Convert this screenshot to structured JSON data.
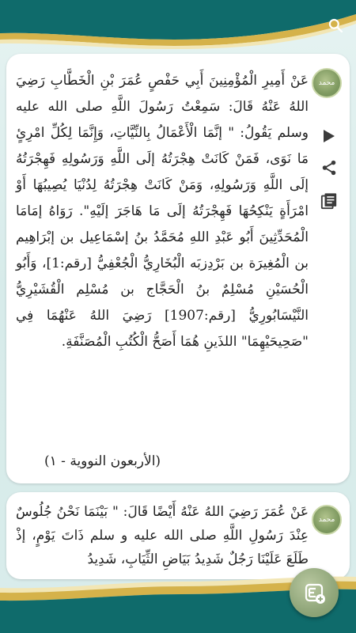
{
  "colors": {
    "header_teal": "#0f6b6b",
    "gold": "#d5b24a",
    "badge_green": "#7f9a61",
    "icon_dark": "#3b3b3b"
  },
  "icons": {
    "search": "search-icon",
    "play": "play-icon",
    "share": "share-icon",
    "notes": "notes-icon",
    "language": "language-icon"
  },
  "hadiths": [
    {
      "badge_label": "محمد",
      "text": "عَنْ أَمِيرِ الْمُؤْمِنِينَ أَبِي حَفْصٍ عُمَرَ بْنِ الْخَطَّابِ رَضِيَ اللهُ عَنْهُ قَالَ: سَمِعْتُ رَسُولَ اللَّهِ صلى الله عليه وسلم يَقُولُ: \" إنَّمَا الْأَعْمَالُ بِالنِّيَّاتِ، وَإِنَّمَا لِكُلِّ امْرِئٍ مَا نَوَى، فَمَنْ كَانَتْ هِجْرَتُهُ إلَى اللَّهِ وَرَسُولِهِ فَهِجْرَتُهُ إلَى اللَّهِ وَرَسُولِهِ، وَمَنْ كَانَتْ هِجْرَتُهُ لِدُنْيَا يُصِيبُهَا أَوْ امْرَأَةٍ يَنْكِحُهَا فَهِجْرَتُهُ إلَى مَا هَاجَرَ إلَيْهِ\". رَوَاهُ إمَامَا الْمُحَدِّثِينَ أَبُو عَبْدِ اللهِ مُحَمَّدُ بنُ إسْمَاعِيل بن إبْرَاهِيم بن الْمُغِيرَة بن بَرْدِزبَه الْبُخَارِيُّ الْجُعْفِيُّ [رقم:1]، وَأَبُو الْحُسَيْنِ مُسْلِمٌ بنُ الْحَجَّاج بن مُسْلِم الْقُشَيْرِيُّ النَّيْسَابُورِيُّ [رقم:1907] رَضِيَ اللهُ عَنْهُمَا فِي \"صَحِيحَيْهِمَا\" اللذَينِ هُمَا أَصَحُّ الْكُتُبِ الْمُصَنَّفَةِ.",
      "source": "(الأربعون النووية - ١)"
    },
    {
      "badge_label": "محمد",
      "text": "عَنْ عُمَرَ رَضِيَ اللهُ عَنْهُ أَيْضًا قَالَ: \" بَيْنَمَا نَحْنُ جُلُوسٌ عِنْدَ رَسُولِ اللَّهِ صلى الله عليه و سلم ذَاتَ يَوْمٍ، إذْ طَلَعَ عَلَيْنَا رَجُلٌ شَدِيدُ بَيَاضِ الثِّيَابِ، شَدِيدُ"
    }
  ]
}
